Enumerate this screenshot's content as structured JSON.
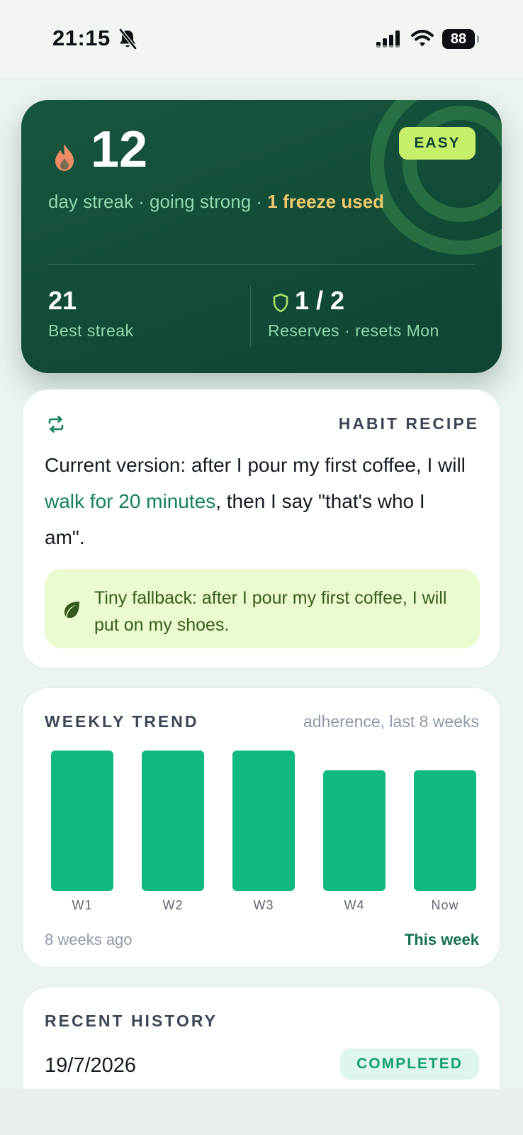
{
  "status_bar": {
    "time": "21:15",
    "battery": "88",
    "icons": [
      "bell-slash-icon",
      "cellular-signal-icon",
      "wifi-icon",
      "battery-icon"
    ]
  },
  "streak": {
    "count": "12",
    "difficulty": "EASY",
    "subtitle_main": "day streak · going strong · ",
    "subtitle_warning": "1 freeze used",
    "best_value": "21",
    "best_label": "Best streak",
    "reserves_value": "1 / 2",
    "reserves_label": "Reserves · resets Mon",
    "icons": [
      "flame-icon",
      "shield-icon"
    ]
  },
  "recipe": {
    "title": "HABIT RECIPE",
    "text_before": "Current version: after I pour my first coffee, I will ",
    "text_highlight": "walk for 20 minutes",
    "text_after": ", then I say \"that's who I am\".",
    "fallback": "Tiny fallback: after I pour my first coffee, I will put on my shoes.",
    "icons": [
      "repeat-icon",
      "leaf-icon"
    ]
  },
  "trend": {
    "title": "WEEKLY TREND",
    "note": "adherence, last 8 weeks",
    "foot_left": "8 weeks ago",
    "foot_right": "This week"
  },
  "chart_data": {
    "type": "bar",
    "categories": [
      "W1",
      "W2",
      "W3",
      "W4",
      "Now"
    ],
    "values": [
      100,
      100,
      100,
      86,
      86
    ],
    "ylim": [
      0,
      100
    ],
    "grid": false,
    "bar_color": "#10b981"
  },
  "history": {
    "title": "RECENT HISTORY",
    "date": "19/7/2026",
    "status": "COMPLETED"
  },
  "colors": {
    "accent": "#148257",
    "hero_bg": "#114c37",
    "badge_easy": "#c7f06a",
    "completed": "#15a06d"
  }
}
